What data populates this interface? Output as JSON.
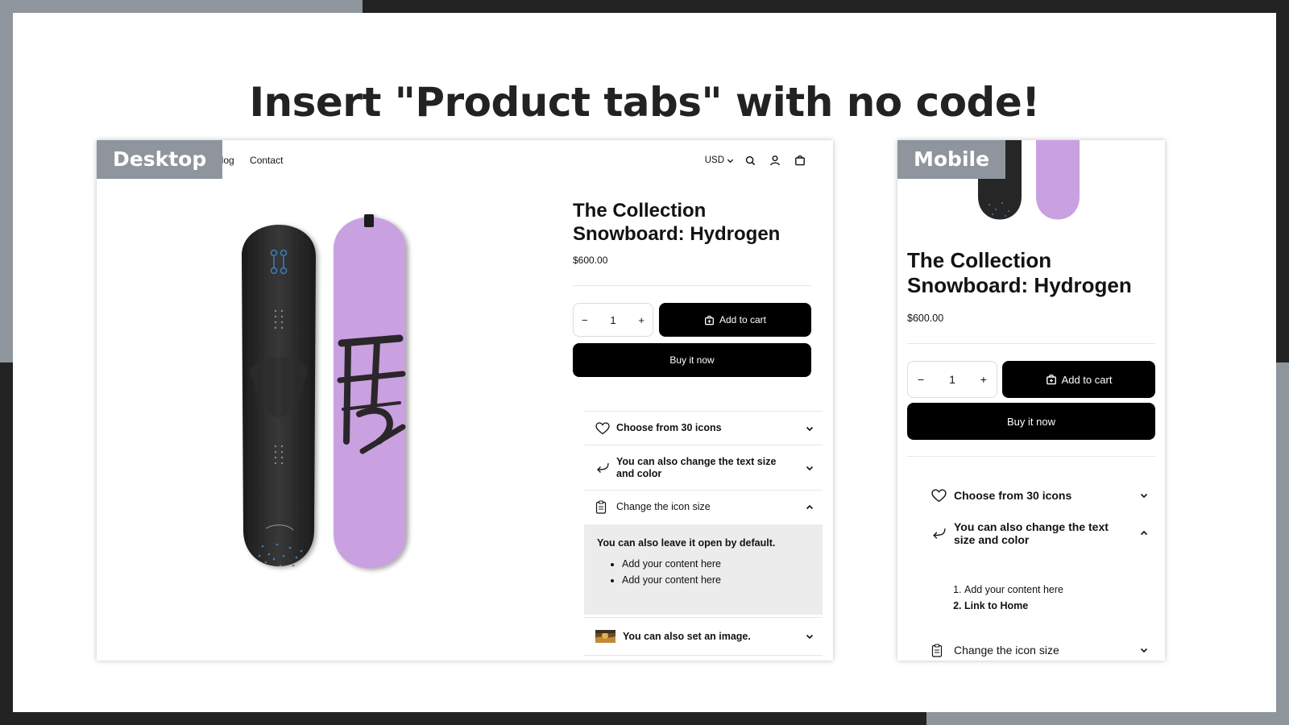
{
  "headline": "Insert \"Product tabs\" with no code!",
  "desktop": {
    "tag": "Desktop",
    "nav": {
      "catalog": "atalog",
      "contact": "Contact",
      "currency": "USD"
    },
    "product": {
      "title": "The Collection Snowboard: Hydrogen",
      "price": "$600.00",
      "qty": "1",
      "add_to_cart": "Add to cart",
      "buy_now": "Buy it now"
    },
    "tabs": [
      {
        "icon": "heart-icon",
        "label": "Choose from 30 icons",
        "open": false
      },
      {
        "icon": "return-arrow-icon",
        "label": "You can also change the text size and color",
        "open": false
      },
      {
        "icon": "clipboard-icon",
        "label": "Change the icon size",
        "open": true,
        "content": {
          "heading": "You can also leave it open by default.",
          "items": [
            "Add your content here",
            "Add your content here"
          ]
        }
      },
      {
        "icon": "image-thumbnail-icon",
        "label": "You can also set an image.",
        "open": false
      }
    ]
  },
  "mobile": {
    "tag": "Mobile",
    "product": {
      "title": "The Collection Snowboard: Hydrogen",
      "price": "$600.00",
      "qty": "1",
      "add_to_cart": "Add to cart",
      "buy_now": "Buy it now"
    },
    "tabs": [
      {
        "icon": "heart-icon",
        "label": "Choose from 30 icons",
        "open": false
      },
      {
        "icon": "return-arrow-icon",
        "label": "You can also change the text size and color",
        "open": true,
        "content": {
          "items": [
            "Add your content here",
            "Link to Home"
          ]
        }
      },
      {
        "icon": "clipboard-icon",
        "label": "Change the icon size",
        "open": false
      }
    ]
  },
  "colors": {
    "board_dark": "#2b2b2b",
    "board_purple": "#c9a0e0",
    "accent_blue": "#3a7fc0",
    "tag_gray": "#8f959c"
  }
}
